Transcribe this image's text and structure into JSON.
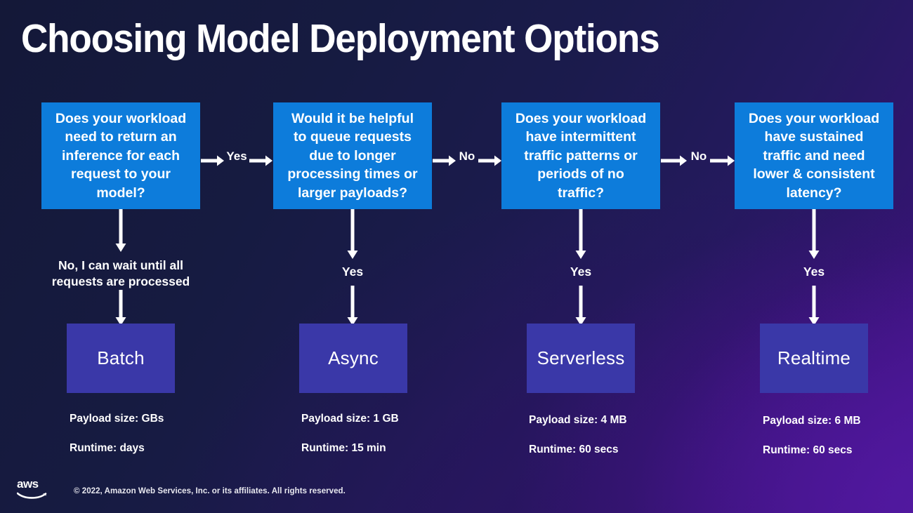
{
  "slide": {
    "title": "Choosing Model Deployment Options",
    "colors": {
      "decision_box": "#0d7cdb",
      "result_box": "#3a38a8",
      "background_dark": "#12163a",
      "background_purple": "#45128c",
      "text": "#ffffff",
      "arrow": "#ffffff"
    }
  },
  "decisions": [
    {
      "id": "q1",
      "text": "Does your workload\nneed to return an\ninference for each\nrequest to your\nmodel?"
    },
    {
      "id": "q2",
      "text": "Would it be helpful\nto queue requests\ndue to longer\nprocessing times or\nlarger payloads?"
    },
    {
      "id": "q3",
      "text": "Does your workload\nhave intermittent\ntraffic patterns or\nperiods of no\ntraffic?"
    },
    {
      "id": "q4",
      "text": "Does your workload\nhave sustained\ntraffic and need\nlower & consistent\nlatency?"
    }
  ],
  "horizontal_labels": [
    {
      "id": "q1_to_q2",
      "text": "Yes"
    },
    {
      "id": "q2_to_q3",
      "text": "No"
    },
    {
      "id": "q3_to_q4",
      "text": "No"
    }
  ],
  "vertical_labels": [
    {
      "id": "q1_down",
      "text": "No, I can wait until all\nrequests are processed"
    },
    {
      "id": "q2_down",
      "text": "Yes"
    },
    {
      "id": "q3_down",
      "text": "Yes"
    },
    {
      "id": "q4_down",
      "text": "Yes"
    }
  ],
  "results": [
    {
      "id": "batch",
      "name": "Batch",
      "payload": "Payload size: GBs",
      "runtime": "Runtime: days"
    },
    {
      "id": "async",
      "name": "Async",
      "payload": "Payload size: 1 GB",
      "runtime": "Runtime: 15 min"
    },
    {
      "id": "serverless",
      "name": "Serverless",
      "payload": "Payload size: 4 MB",
      "runtime": "Runtime: 60 secs"
    },
    {
      "id": "realtime",
      "name": "Realtime",
      "payload": "Payload size: 6 MB",
      "runtime": "Runtime: 60 secs"
    }
  ],
  "footer": {
    "logo": "aws-logo",
    "wordmark": "aws",
    "copyright": "© 2022, Amazon Web Services, Inc. or its affiliates. All rights reserved."
  }
}
